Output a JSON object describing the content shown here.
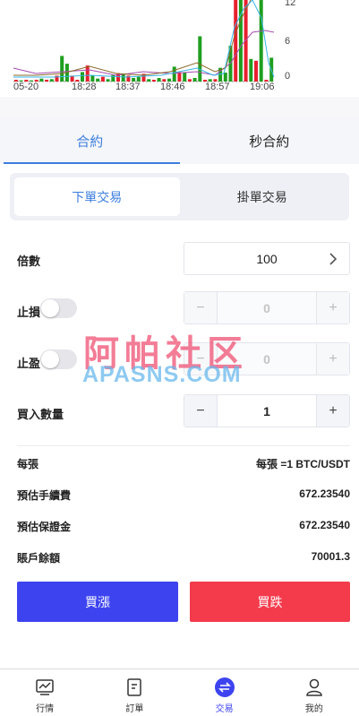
{
  "chart_data": {
    "type": "bar",
    "x_tick_labels": [
      "05-20",
      "18:28",
      "18:37",
      "18:46",
      "18:57",
      "19:06"
    ],
    "y_tick_labels": [
      "12",
      "6",
      "0"
    ],
    "ylim": [
      0,
      14
    ],
    "series": [
      {
        "values": [
          0.3,
          0.2,
          0.3,
          0.2,
          0.3,
          0.5,
          0.3,
          0.4,
          1.0,
          4.3,
          3.0,
          1.0,
          0.3,
          1.6,
          2.7,
          1.0,
          0.5,
          0.8,
          0.4,
          1.1,
          1.4,
          1.3,
          1.0,
          0.6,
          0.8,
          1.3,
          0.4,
          0.3,
          0.6,
          0.4,
          0.5,
          2.5,
          1.6,
          1.5,
          0.4,
          0.6,
          7.6,
          0.3,
          0.4,
          0.4,
          2.3,
          1.5,
          6.0,
          14.5,
          14.5,
          14.5,
          3.8,
          3.5,
          14.5,
          0.3,
          4.0
        ],
        "colors": [
          "red",
          "green",
          "red",
          "green",
          "red",
          "green",
          "red",
          "green",
          "red",
          "green",
          "green",
          "red",
          "red",
          "green",
          "red",
          "green",
          "green",
          "red",
          "green",
          "green",
          "red",
          "green",
          "red",
          "green",
          "green",
          "red",
          "green",
          "red",
          "green",
          "red",
          "green",
          "green",
          "red",
          "green",
          "red",
          "green",
          "green",
          "red",
          "green",
          "red",
          "green",
          "green",
          "green",
          "red",
          "green",
          "red",
          "green",
          "red",
          "green",
          "red",
          "green"
        ]
      }
    ]
  },
  "tabs": [
    "合約",
    "秒合約"
  ],
  "order_types": [
    "下單交易",
    "掛單交易"
  ],
  "form": {
    "leverage_label": "倍數",
    "leverage_value": "100",
    "stop_loss_label": "止損",
    "stop_loss_value": "0",
    "take_profit_label": "止盈",
    "take_profit_value": "0",
    "quantity_label": "買入數量",
    "quantity_value": "1",
    "minus": "−",
    "plus": "+"
  },
  "info": {
    "per_lot_label": "每張",
    "per_lot_value": "每張 =1 BTC/USDT",
    "fee_label": "預估手續費",
    "fee_value": "672.23540",
    "margin_label": "預估保證金",
    "margin_value": "672.23540",
    "balance_label": "賬戶餘額",
    "balance_value": "70001.3"
  },
  "actions": {
    "buy_label": "買漲",
    "sell_label": "買跌"
  },
  "watermark": {
    "cn": "阿帕社区",
    "en": "APASNS.COM"
  },
  "nav": [
    {
      "label": "行情",
      "icon": "market-chart-icon"
    },
    {
      "label": "訂單",
      "icon": "orders-document-icon"
    },
    {
      "label": "交易",
      "icon": "trade-swap-icon"
    },
    {
      "label": "我的",
      "icon": "profile-user-icon"
    }
  ],
  "colors": {
    "accent": "#3b7ddd",
    "buy": "#3d44ef",
    "sell": "#f33b4c",
    "bar_up": "#1f9e1f",
    "bar_down": "#e8202e"
  }
}
